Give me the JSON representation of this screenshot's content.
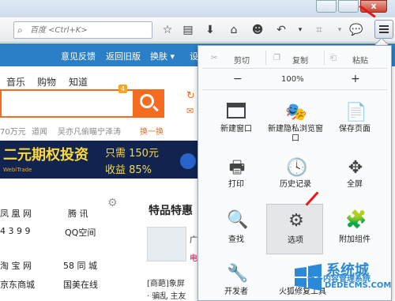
{
  "browser": {
    "search_placeholder": "百度 <Ctrl+K>",
    "window_close_glyph": "x"
  },
  "page": {
    "top_links": [
      "意见反馈",
      "返回旧版",
      "换肤 ▾",
      "设"
    ],
    "categories": [
      "音乐",
      "购物",
      "知道"
    ],
    "search_badge": "4",
    "hot_words": [
      "70万元",
      "道闻",
      "吴亦凡偷瞄宁泽涛",
      "换一换"
    ],
    "banner": {
      "headline": "二元期权投资",
      "line1": "只需 150元",
      "line2": "收益 85%",
      "brand": "WebiTrade"
    },
    "sites": [
      [
        "凤 凰 网",
        "腾 讯"
      ],
      [
        "4 3 9 9",
        "QQ空间"
      ],
      [
        "淘 宝 网",
        "58 同 城"
      ],
      [
        "京东商城",
        "国美在线"
      ]
    ],
    "special_title": "特品特惠",
    "news": [
      "广",
      "电",
      "[商葩]象屏",
      "· 骗乱 主友"
    ]
  },
  "menu": {
    "cut": "剪切",
    "copy": "复制",
    "paste": "粘贴",
    "zoom_minus": "−",
    "zoom_value": "100%",
    "zoom_plus": "+",
    "tiles": [
      {
        "label": "新建窗口"
      },
      {
        "label": "新建隐私浏览窗口"
      },
      {
        "label": "保存页面"
      },
      {
        "label": "打印"
      },
      {
        "label": "历史记录"
      },
      {
        "label": "全屏"
      },
      {
        "label": "查找"
      },
      {
        "label": "选项"
      },
      {
        "label": "附加组件"
      },
      {
        "label": "开发者"
      },
      {
        "label": "火狐修复工具"
      }
    ]
  },
  "watermark": {
    "name": "系统城",
    "line1": "维多内容管理系统",
    "line2": "DEDECMS.COM"
  },
  "colors": {
    "accent_blue": "#2b7fc6",
    "search_orange": "#f56b1f",
    "annotation_red": "#e81818"
  }
}
